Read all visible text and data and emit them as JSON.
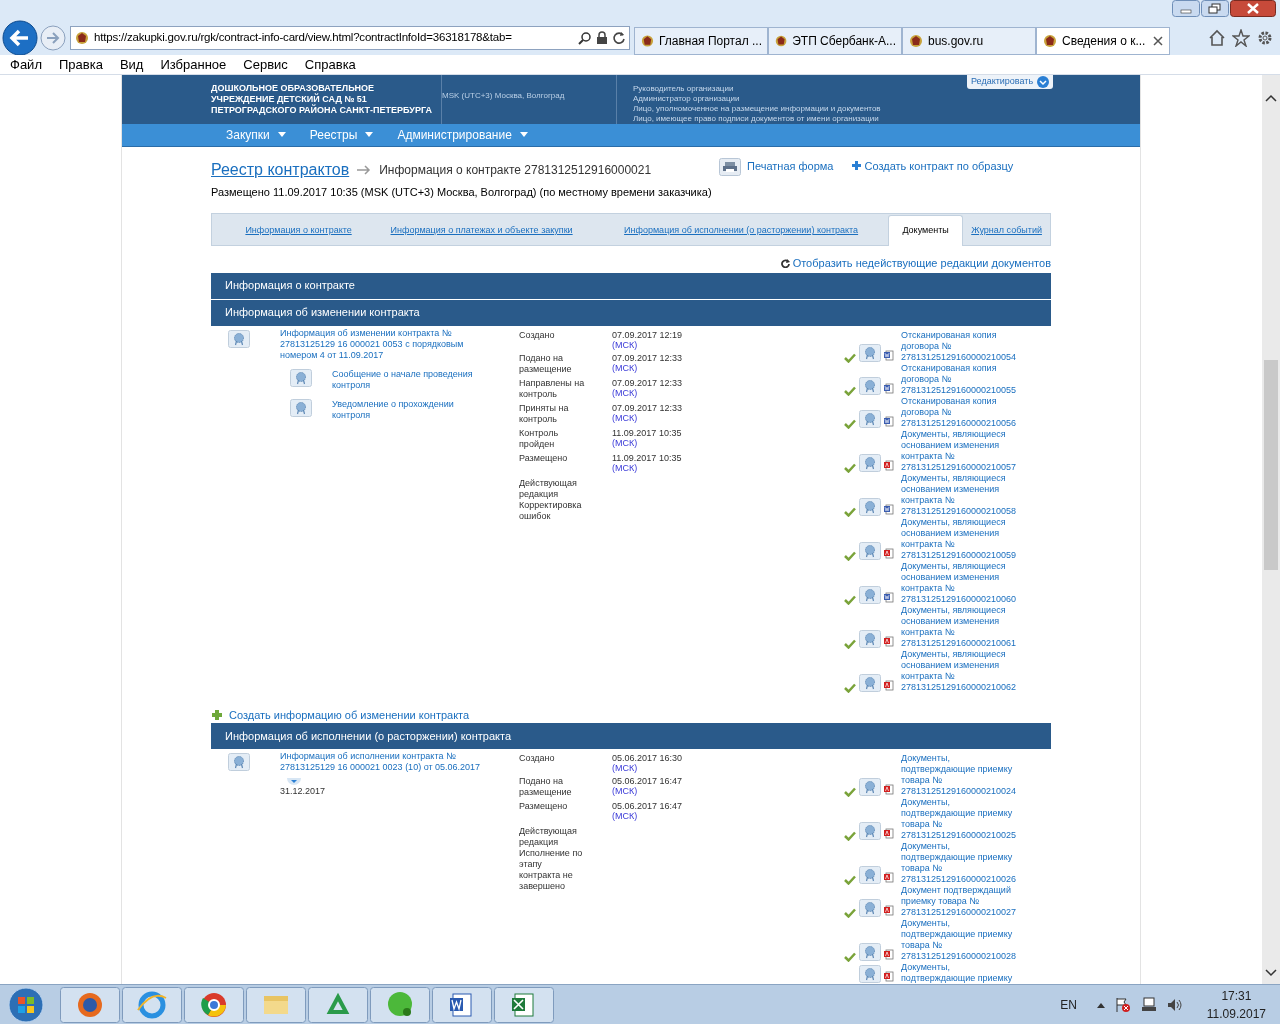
{
  "browser": {
    "url": "https://zakupki.gov.ru/rgk/contract-info-card/view.html?contractInfoId=36318178&tab=",
    "tabs": [
      {
        "title": "Главная Портал ...",
        "selected": false
      },
      {
        "title": "ЭТП Сбербанк-А...",
        "selected": false
      },
      {
        "title": "bus.gov.ru",
        "selected": false
      },
      {
        "title": "Сведения о к...",
        "selected": true
      }
    ],
    "menu": [
      "Файл",
      "Правка",
      "Вид",
      "Избранное",
      "Сервис",
      "Справка"
    ]
  },
  "header": {
    "org_lines": [
      "ДОШКОЛЬНОЕ ОБРАЗОВАТЕЛЬНОЕ",
      "УЧРЕЖДЕНИЕ ДЕТСКИЙ САД № 51",
      "ПЕТРОГРАДСКОГО РАЙОНА САНКТ-ПЕТЕРБУРГА"
    ],
    "timezone": "MSK (UTC+3) Москва, Волгоград",
    "roles": [
      "Руководитель организации",
      "Администратор организации",
      "Лицо, уполномоченное на размещение информации и документов",
      "Лицо, имеющее право подписи документов от имени организации"
    ],
    "edit_button": "Редактировать"
  },
  "nav": [
    "Закупки",
    "Реестры",
    "Администрирование"
  ],
  "breadcrumb": {
    "link": "Реестр контрактов",
    "current": "Информация о контракте 2781312512916000021"
  },
  "posted": "Размещено 11.09.2017 10:35 (MSK (UTC+3) Москва, Волгоград) (по местному времени заказчика)",
  "actions": {
    "print": "Печатная форма",
    "create_sample": "Создать контракт по образцу"
  },
  "tabs": [
    {
      "label": "Информация о контракте",
      "selected": false
    },
    {
      "label": "Информация о платежах и объекте закупки",
      "selected": false
    },
    {
      "label": "Информация об исполнении (о расторжении) контракта",
      "selected": false
    },
    {
      "label": "Документы",
      "selected": true
    },
    {
      "label": "Журнал событий",
      "selected": false
    }
  ],
  "show_inactive": "Отобразить недействующие редакции документов",
  "contract_section": {
    "title": "Информация о контракте"
  },
  "change_section": {
    "title": "Информация об изменении контракта",
    "entry": {
      "title": "Информация об изменении контракта № 27813125129 16 000021 0053 с порядковым номером 4 от 11.09.2017",
      "subdocs": [
        "Сообщение о начале проведения контроля",
        "Уведомление о прохождении контроля"
      ],
      "events": [
        {
          "label": "Создано",
          "date": "07.09.2017 12:19",
          "tz": "(МСК)"
        },
        {
          "label": "Подано на размещение",
          "date": "07.09.2017 12:33",
          "tz": "(МСК)"
        },
        {
          "label": "Направлены на контроль",
          "date": "07.09.2017 12:33",
          "tz": "(МСК)"
        },
        {
          "label": "Приняты на контроль",
          "date": "07.09.2017 12:33",
          "tz": "(МСК)"
        },
        {
          "label": "Контроль пройден",
          "date": "11.09.2017 10:35",
          "tz": "(МСК)"
        },
        {
          "label": "Размещено",
          "date": "11.09.2017 10:35",
          "tz": "(МСК)"
        }
      ],
      "status": [
        "Действующая редакция",
        "Корректировка ошибок"
      ],
      "documents": [
        {
          "title": "Отсканированая копия договора № 27813125129160000210054",
          "kind": "word",
          "signed": true
        },
        {
          "title": "Отсканированая копия договора № 27813125129160000210055",
          "kind": "word",
          "signed": true
        },
        {
          "title": "Отсканированая копия договора № 27813125129160000210056",
          "kind": "word",
          "signed": true
        },
        {
          "title": "Документы, являющиеся основанием изменения контракта № 27813125129160000210057",
          "kind": "pdf",
          "signed": true
        },
        {
          "title": "Документы, являющиеся основанием изменения контракта № 27813125129160000210058",
          "kind": "word",
          "signed": true
        },
        {
          "title": "Документы, являющиеся основанием изменения контракта № 27813125129160000210059",
          "kind": "pdf",
          "signed": true
        },
        {
          "title": "Документы, являющиеся основанием изменения контракта № 27813125129160000210060",
          "kind": "word",
          "signed": true
        },
        {
          "title": "Документы, являющиеся основанием изменения контракта № 27813125129160000210061",
          "kind": "pdf",
          "signed": true
        },
        {
          "title": "Документы, являющиеся основанием изменения контракта № 27813125129160000210062",
          "kind": "pdf",
          "signed": true
        }
      ]
    }
  },
  "create_change": "Создать информацию об изменении контракта",
  "execution_section": {
    "title": "Информация об исполнении (о расторжении) контракта",
    "entry": {
      "title": "Информация об исполнении контракта № 27813125129 16 000021 0023 (10) от 05.06.2017",
      "date": "31.12.2017",
      "events": [
        {
          "label": "Создано",
          "date": "05.06.2017 16:30",
          "tz": "(МСК)"
        },
        {
          "label": "Подано на размещение",
          "date": "05.06.2017 16:47",
          "tz": "(МСК)"
        },
        {
          "label": "Размещено",
          "date": "05.06.2017 16:47",
          "tz": "(МСК)"
        }
      ],
      "status": [
        "Действующая редакция",
        "Исполнение по этапу контракта не завершено"
      ],
      "documents": [
        {
          "title": "Документы, подтверждающие приемку товара № 27813125129160000210024",
          "kind": "pdf",
          "signed": true
        },
        {
          "title": "Документы, подтверждающие приемку товара № 27813125129160000210025",
          "kind": "pdf",
          "signed": true
        },
        {
          "title": "Документы, подтверждающие приемку товара № 27813125129160000210026",
          "kind": "pdf",
          "signed": true
        },
        {
          "title": "Документ подтверждащий приемку товара № 27813125129160000210027",
          "kind": "pdf",
          "signed": true
        },
        {
          "title": "Документы, подтверждающие приемку товара № 27813125129160000210028",
          "kind": "pdf",
          "signed": true
        },
        {
          "title": "Документы, подтверждающие приемку",
          "kind": "pdf"
        }
      ]
    }
  },
  "taskbar": {
    "language": "EN",
    "time": "17:31",
    "date": "11.09.2017"
  }
}
